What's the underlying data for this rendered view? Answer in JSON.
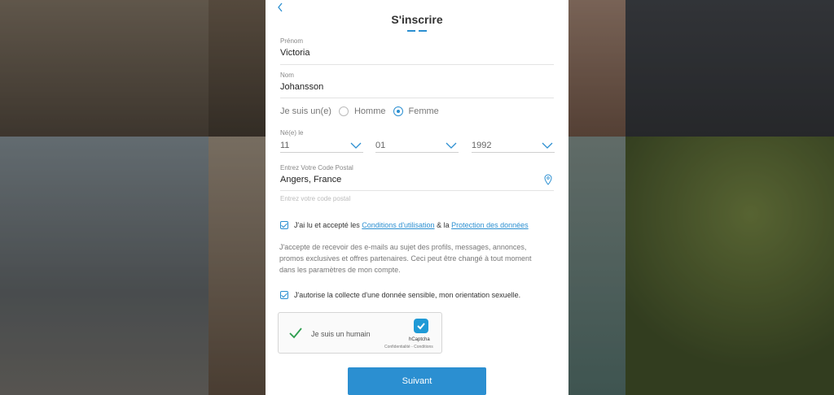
{
  "colors": {
    "accent": "#2b8fd1"
  },
  "header": {
    "title": "S'inscrire",
    "back_icon": "chevron-left-icon"
  },
  "form": {
    "prenom": {
      "label": "Prénom",
      "value": "Victoria"
    },
    "nom": {
      "label": "Nom",
      "value": "Johansson"
    },
    "gender": {
      "label": "Je suis un(e)",
      "options": [
        "Homme",
        "Femme"
      ],
      "selected": "Femme"
    },
    "birth": {
      "label": "Né(e) le",
      "day": "11",
      "month": "01",
      "year": "1992"
    },
    "postal": {
      "label": "Entrez Votre Code Postal",
      "value": "Angers, France",
      "hint": "Entrez votre code postal"
    },
    "terms": {
      "prefix": "J'ai lu et accepté les",
      "link1": "Conditions d'utilisation",
      "middle": "& la",
      "link2": "Protection des données",
      "checked": true
    },
    "promo_text": "J'accepte de recevoir des e-mails au sujet des profils, messages, annonces, promos exclusives et offres partenaires. Ceci peut être changé à tout moment dans les paramètres de mon compte.",
    "consent": {
      "text": "J'autorise la collecte d'une donnée sensible, mon orientation sexuelle.",
      "checked": true
    }
  },
  "captcha": {
    "label": "Je suis un humain",
    "brand": "hCaptcha",
    "legal": "Confidentialité - Conditions"
  },
  "submit": {
    "label": "Suivant"
  }
}
